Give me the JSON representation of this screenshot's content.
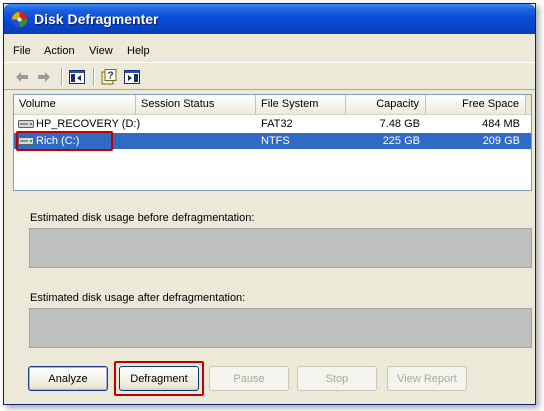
{
  "window": {
    "title": "Disk Defragmenter"
  },
  "menu": {
    "items": [
      "File",
      "Action",
      "View",
      "Help"
    ]
  },
  "toolbar": {
    "icons": [
      "back-arrow-icon",
      "forward-arrow-icon",
      "show-hide-tree-icon",
      "help-icon",
      "properties-icon"
    ]
  },
  "volumes": {
    "columns": [
      "Volume",
      "Session Status",
      "File System",
      "Capacity",
      "Free Space"
    ],
    "rows": [
      {
        "volume": "HP_RECOVERY (D:)",
        "status": "",
        "fs": "FAT32",
        "capacity": "7.48 GB",
        "free": "484 MB",
        "selected": false
      },
      {
        "volume": "Rich (C:)",
        "status": "",
        "fs": "NTFS",
        "capacity": "225 GB",
        "free": "209 GB",
        "selected": true
      }
    ]
  },
  "usage": {
    "before_label": "Estimated disk usage before defragmentation:",
    "after_label": "Estimated disk usage after defragmentation:"
  },
  "buttons": {
    "analyze": "Analyze",
    "defragment": "Defragment",
    "pause": "Pause",
    "stop": "Stop",
    "view_report": "View Report"
  },
  "colors": {
    "selection": "#316ac5",
    "annotation": "#c00000",
    "title_bar": "#0a4ed8"
  }
}
